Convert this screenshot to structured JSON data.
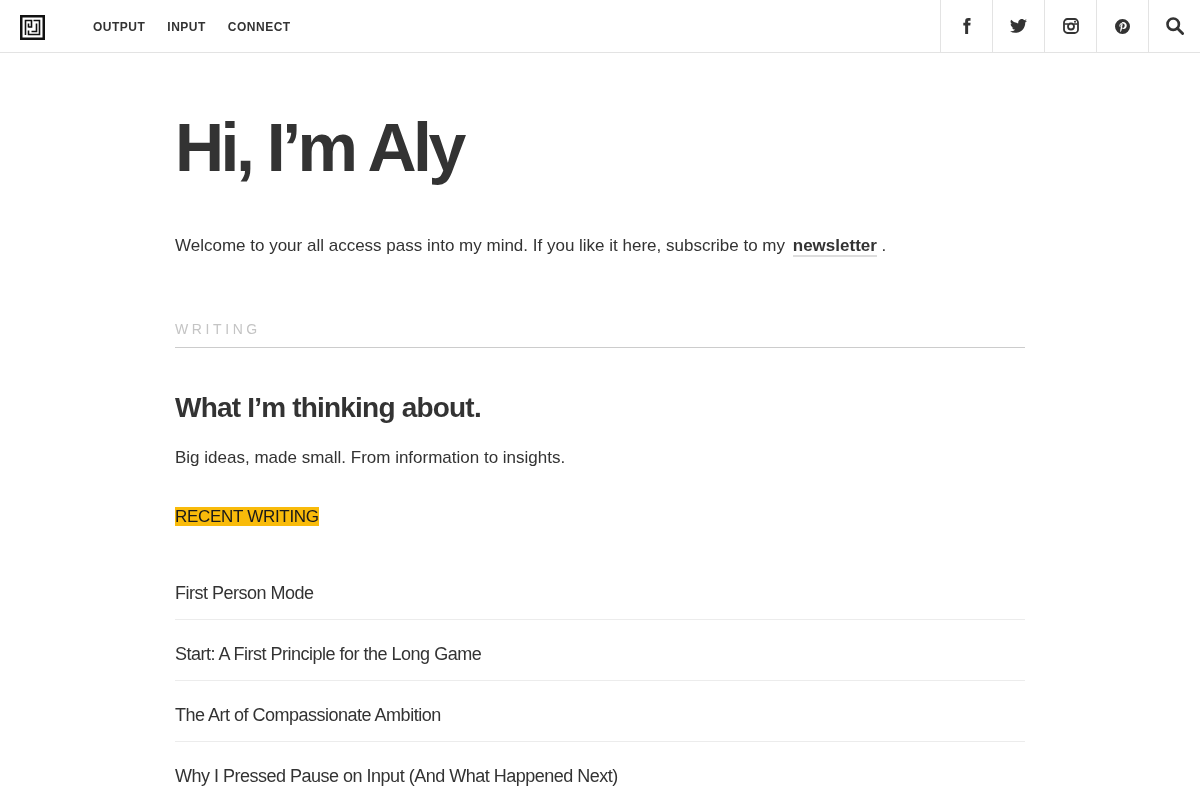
{
  "header": {
    "nav": [
      {
        "label": "OUTPUT"
      },
      {
        "label": "INPUT"
      },
      {
        "label": "CONNECT"
      }
    ]
  },
  "intro": {
    "title": "Hi, I’m Aly",
    "text_before": "Welcome to your all access pass into my mind. If you like it here, subscribe to my",
    "link": "newsletter",
    "text_after": "."
  },
  "writing": {
    "section_label": "WRITING",
    "heading": "What I’m thinking about.",
    "subheading": "Big ideas, made small. From information to insights.",
    "highlight": "RECENT WRITING",
    "posts": [
      {
        "title": "First Person Mode"
      },
      {
        "title": "Start: A First Principle for the Long Game"
      },
      {
        "title": "The Art of Compassionate Ambition"
      },
      {
        "title": "Why I Pressed Pause on Input (And What Happened Next)"
      }
    ]
  }
}
